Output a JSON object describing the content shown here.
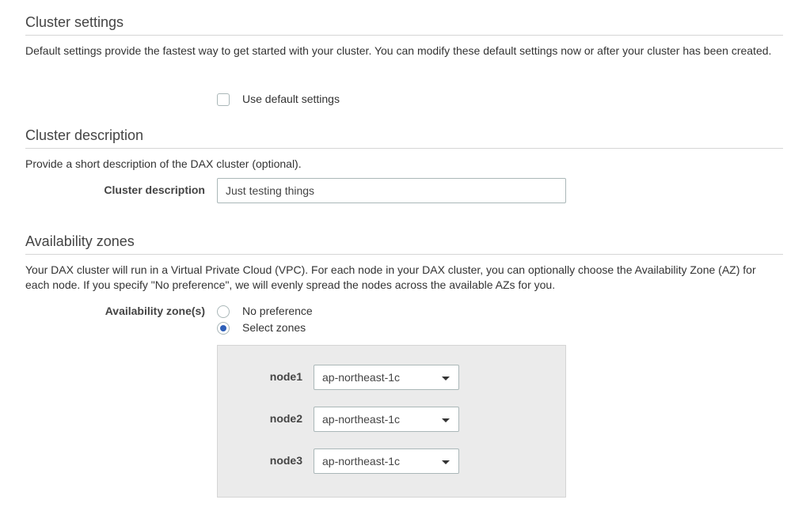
{
  "cluster_settings": {
    "title": "Cluster settings",
    "description": "Default settings provide the fastest way to get started with your cluster. You can modify these default settings now or after your cluster has been created.",
    "use_default_label": "Use default settings",
    "use_default_checked": false
  },
  "cluster_description": {
    "title": "Cluster description",
    "description": "Provide a short description of the DAX cluster (optional).",
    "field_label": "Cluster description",
    "field_value": "Just testing things"
  },
  "availability_zones": {
    "title": "Availability zones",
    "description": "Your DAX cluster will run in a Virtual Private Cloud (VPC). For each node in your DAX cluster, you can optionally choose the Availability Zone (AZ) for each node. If you specify \"No preference\", we will evenly spread the nodes across the available AZs for you.",
    "field_label": "Availability zone(s)",
    "options": {
      "no_preference": "No preference",
      "select_zones": "Select zones"
    },
    "selected_option": "select_zones",
    "nodes": [
      {
        "label": "node1",
        "zone": "ap-northeast-1c"
      },
      {
        "label": "node2",
        "zone": "ap-northeast-1c"
      },
      {
        "label": "node3",
        "zone": "ap-northeast-1c"
      }
    ]
  },
  "colors": {
    "radio_selected": "#2e5fb8",
    "panel_background": "#ebebeb",
    "divider": "#d5d5d5"
  },
  "icons": {
    "dropdown": "caret-down-icon"
  }
}
